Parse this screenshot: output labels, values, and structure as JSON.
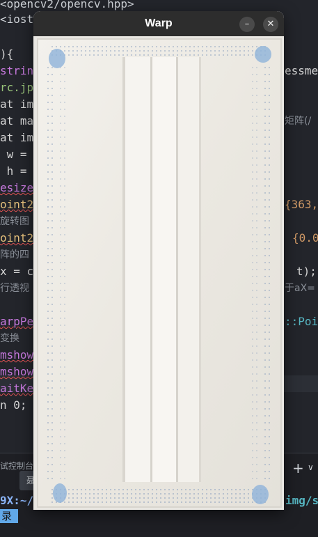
{
  "editor": {
    "lines": [
      {
        "text": "<opencv2/opencv.hpp>",
        "color": "#cfd3d8"
      },
      {
        "text": "<iost",
        "color": "#cfd3d8"
      },
      {
        "text": "){",
        "color": "#d4d4d4"
      },
      {
        "text": "strin",
        "color": "#c678dd"
      },
      {
        "text": "rc.jp",
        "color": "#98c379"
      },
      {
        "text": "at im",
        "color": "#d4d4d4"
      },
      {
        "text": "at ma",
        "color": "#d4d4d4"
      },
      {
        "text": "at im",
        "color": "#d4d4d4"
      },
      {
        "text": " w = ",
        "color": "#d4d4d4"
      },
      {
        "text": " h = ",
        "color": "#d4d4d4"
      },
      {
        "text": "esize",
        "color": "#c678dd"
      },
      {
        "text": "oint2",
        "color": "#e5c07b"
      },
      {
        "text": "旋转图",
        "color": "#8a8f98"
      },
      {
        "text": "oint2",
        "color": "#e5c07b"
      },
      {
        "text": "阵的四",
        "color": "#8a8f98"
      },
      {
        "text": "x = c",
        "color": "#d4d4d4"
      },
      {
        "text": "行透视",
        "color": "#8a8f98"
      },
      {
        "text": "",
        "color": "#d4d4d4"
      },
      {
        "text": "arpPe",
        "color": "#c678dd"
      },
      {
        "text": "变换",
        "color": "#8a8f98"
      },
      {
        "text": "mshow",
        "color": "#c678dd"
      },
      {
        "text": "mshow",
        "color": "#c678dd"
      },
      {
        "text": "aitKe",
        "color": "#c678dd"
      },
      {
        "text": "n 0;",
        "color": "#d4d4d4"
      }
    ],
    "right_fragments": [
      {
        "text": "essme",
        "color": "#d4d4d4"
      },
      {
        "text": "矩阵(/",
        "color": "#8a8f98"
      },
      {
        "text": "{363,",
        "color": "#d19a66"
      },
      {
        "text": "{0.0",
        "color": "#d19a66"
      },
      {
        "text": "t);",
        "color": "#d4d4d4"
      },
      {
        "text": "于aX=",
        "color": "#8a8f98"
      },
      {
        "text": "::Poi",
        "color": "#56b6c2"
      }
    ]
  },
  "panel": {
    "tab_label": "试控制台",
    "tooltip_label": "聂",
    "plus_label": "+",
    "chevron_label": "∨",
    "prompt_left": "9X:~/",
    "prompt_right": "img/s",
    "selected_text": "录",
    "prompt_colors": {
      "left": "#8ab4f8",
      "right": "#56b6c2"
    }
  },
  "window": {
    "title": "Warp",
    "minimize_label": "–",
    "close_label": "✕",
    "image_description_icon": "face-mask-image"
  }
}
